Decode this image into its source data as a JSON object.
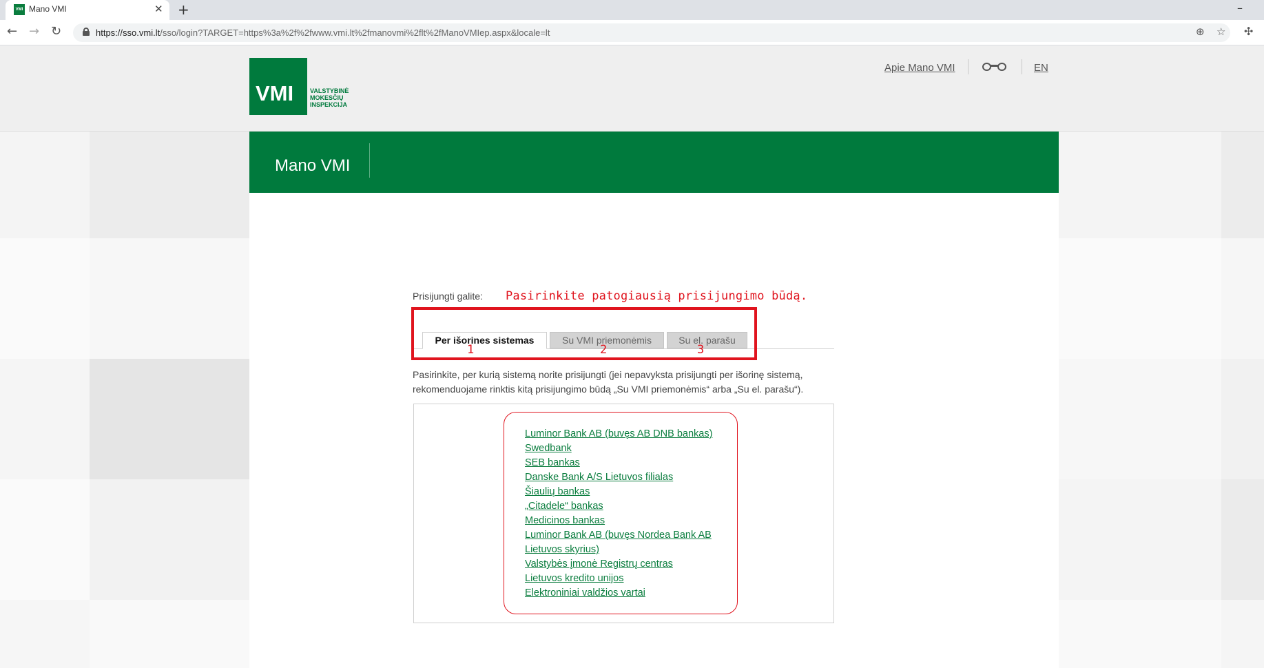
{
  "browser": {
    "tab_title": "Mano VMI",
    "tab_favicon_text": "VMI",
    "url_host": "https://sso.vmi.lt",
    "url_path": "/sso/login?TARGET=https%3a%2f%2fwww.vmi.lt%2fmanovmi%2flt%2fManoVMIep.aspx&locale=lt"
  },
  "header": {
    "logo_text": "VMI",
    "logo_sub": [
      "VALSTYBINĖ",
      "MOKESČIŲ",
      "INSPEKCIJA"
    ],
    "about_link": "Apie Mano VMI",
    "lang_link": "EN"
  },
  "band": {
    "title": "Mano VMI"
  },
  "login": {
    "label": "Prisijungti galite:",
    "tabs": [
      {
        "label": "Per išorines sistemas",
        "active": true
      },
      {
        "label": "Su VMI priemonėmis",
        "active": false
      },
      {
        "label": "Su el. parašu",
        "active": false
      }
    ],
    "description": "Pasirinkite, per kurią sistemą norite prisijungti (jei nepavyksta prisijungti per išorinę sistemą, rekomenduojame rinktis kitą prisijungimo būdą „Su VMI priemonėmis“ arba „Su el. parašu“).",
    "banks": [
      "Luminor Bank AB (buvęs AB DNB bankas)",
      "Swedbank",
      "SEB bankas",
      "Danske Bank A/S Lietuvos filialas",
      "Šiaulių bankas",
      "„Citadele“ bankas",
      "Medicinos bankas",
      "Luminor Bank AB (buvęs Nordea Bank AB Lietuvos skyrius)",
      "Valstybės įmonė Registrų centras",
      "Lietuvos kredito unijos",
      "Elektroniniai valdžios vartai"
    ]
  },
  "annotations": {
    "hint": "Pasirinkite patogiausią prisijungimo būdą.",
    "numbers": [
      "1",
      "2",
      "3"
    ],
    "color": "#e0141e"
  },
  "colors": {
    "brand_green": "#007a3d",
    "link_green": "#0a7d3e"
  },
  "icons": [
    "favicon-icon",
    "close-icon",
    "new-tab-icon",
    "back-icon",
    "forward-icon",
    "reload-icon",
    "lock-icon",
    "zoom-icon",
    "star-icon",
    "extension-icon",
    "glasses-icon"
  ]
}
